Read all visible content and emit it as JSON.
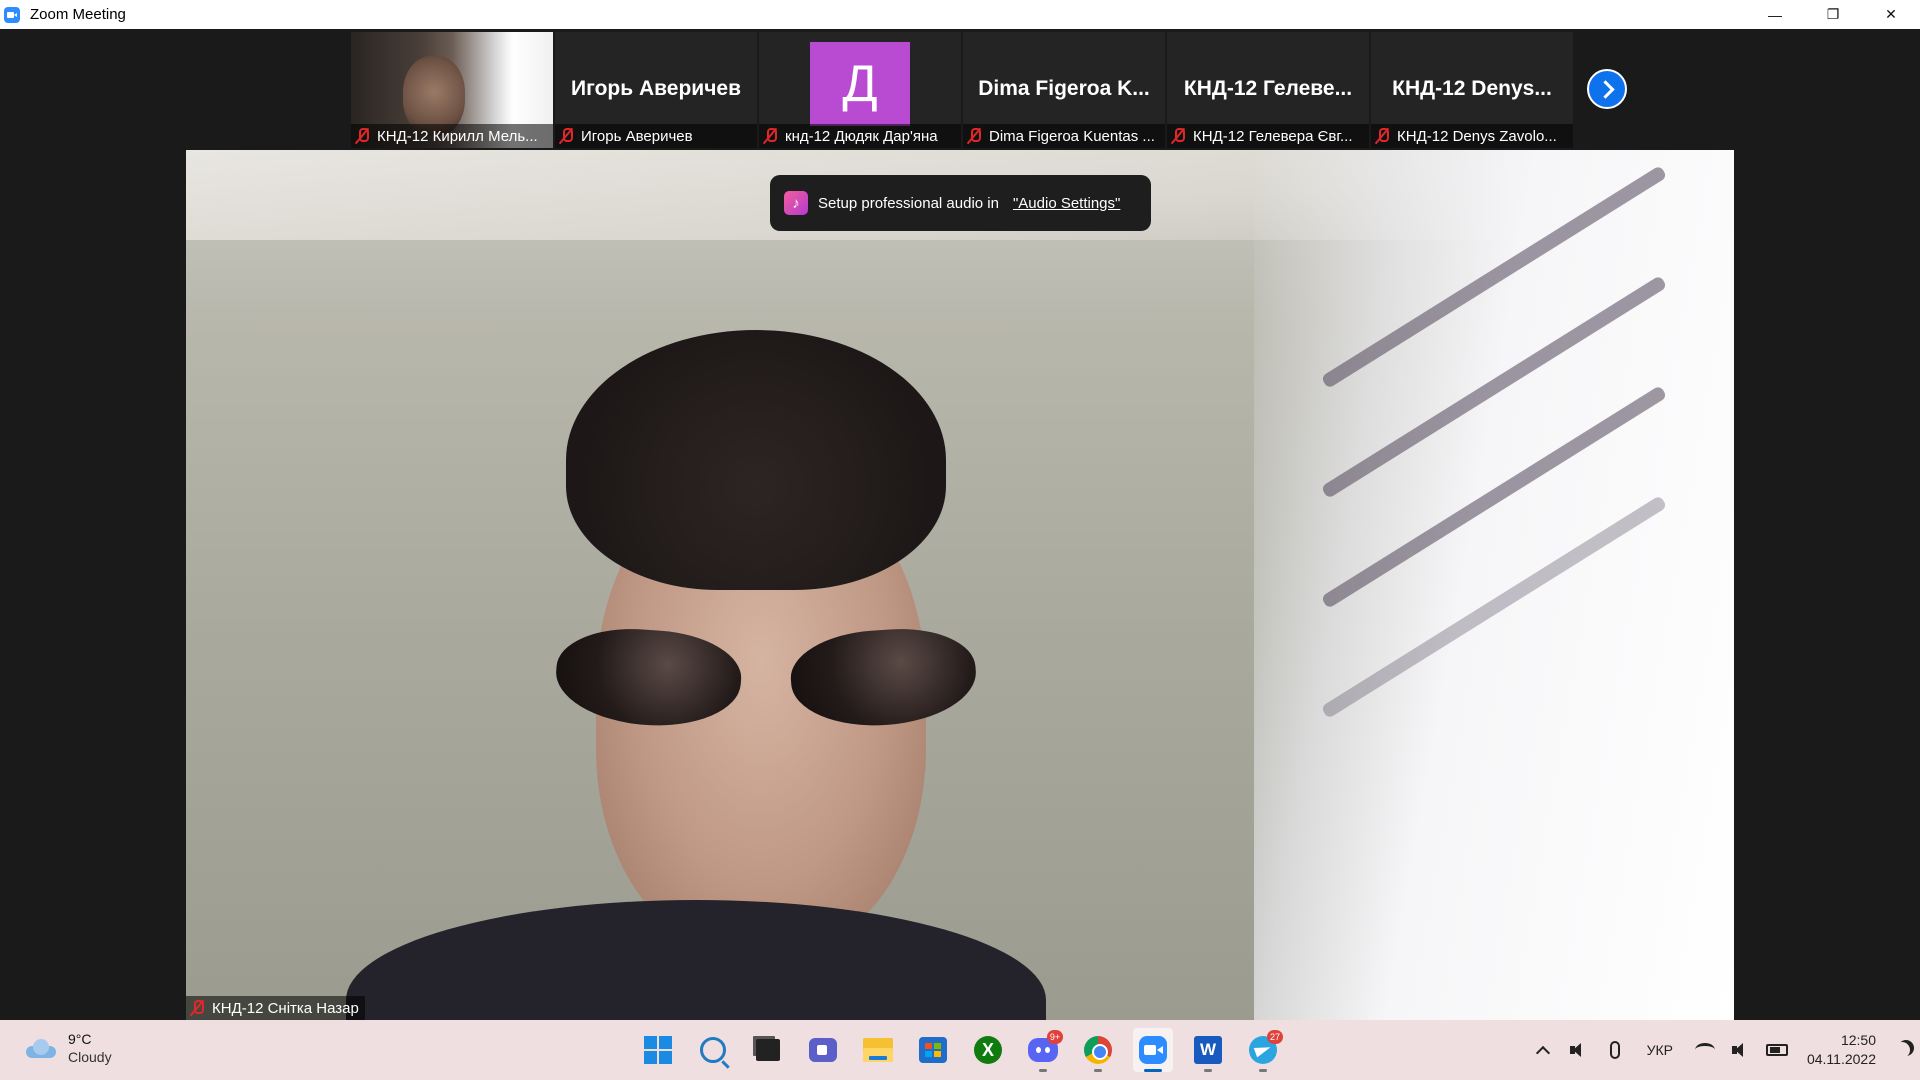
{
  "window": {
    "title": "Zoom Meeting",
    "controls": [
      "minimize",
      "restore",
      "close"
    ]
  },
  "participants": [
    {
      "tile_name": "",
      "label": "КНД-12 Кирилл Мель...",
      "video": true,
      "muted": true
    },
    {
      "tile_name": "Игорь Аверичев",
      "label": "Игорь Аверичев",
      "video": false,
      "muted": true
    },
    {
      "tile_name": "",
      "avatar_letter": "Д",
      "avatar_color": "#b94bd2",
      "label": "кнд-12 Дюдяк Дар'яна",
      "video": false,
      "muted": true
    },
    {
      "tile_name": "Dima Figeroa K...",
      "label": "Dima Figeroa Kuentas ...",
      "video": false,
      "muted": true
    },
    {
      "tile_name": "КНД-12 Гелеве...",
      "label": "КНД-12 Гелевера Євг...",
      "video": false,
      "muted": true
    },
    {
      "tile_name": "КНД-12 Denys...",
      "label": "КНД-12 Denys Zavolo...",
      "video": false,
      "muted": true
    }
  ],
  "active_speaker": {
    "label": "КНД-12 Снітка Назар",
    "muted": true
  },
  "toast": {
    "text": "Setup professional audio in",
    "link": "\"Audio Settings\""
  },
  "taskbar": {
    "weather": {
      "temp": "9°C",
      "condition": "Cloudy"
    },
    "apps": [
      {
        "name": "start",
        "icon": "windows-logo-icon"
      },
      {
        "name": "search",
        "icon": "search-icon"
      },
      {
        "name": "task-view",
        "icon": "task-view-icon"
      },
      {
        "name": "teams-chat",
        "icon": "teams-chat-icon"
      },
      {
        "name": "file-explorer",
        "icon": "folder-icon"
      },
      {
        "name": "microsoft-store",
        "icon": "store-icon"
      },
      {
        "name": "xbox",
        "icon": "xbox-icon"
      },
      {
        "name": "discord",
        "icon": "discord-icon",
        "badge": "9+"
      },
      {
        "name": "chrome",
        "icon": "chrome-icon"
      },
      {
        "name": "zoom",
        "icon": "zoom-icon",
        "active": true
      },
      {
        "name": "word",
        "icon": "word-icon"
      },
      {
        "name": "telegram",
        "icon": "telegram-icon",
        "badge": "27"
      }
    ],
    "tray": {
      "language": "УКР",
      "time": "12:50",
      "date": "04.11.2022"
    }
  }
}
